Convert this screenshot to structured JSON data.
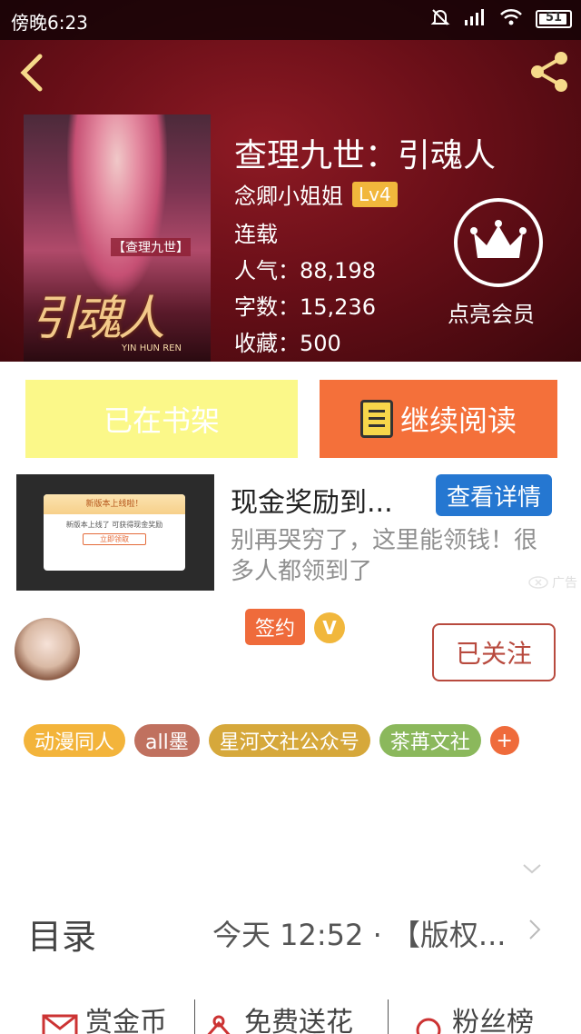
{
  "status_bar": {
    "time": "傍晚6:23",
    "battery": "51"
  },
  "book": {
    "title": "查理九世：引魂人",
    "author": "念卿小姐姐",
    "level": "Lv4",
    "status": "连载",
    "popularity": "人气：88,198",
    "word_count": "字数：15,236",
    "favorites": "收藏：500",
    "cover": {
      "title_art": "引魂人",
      "pinyin": "YIN HUN REN",
      "subtitle": "【查理九世】"
    }
  },
  "membership": {
    "label": "点亮会员"
  },
  "actions": {
    "shelf_label": "已在书架",
    "read_label": "继续阅读"
  },
  "ad": {
    "title": "现金奖励到...",
    "detail_button": "查看详情",
    "description": "别再哭穷了，这里能领钱！很多人都领到了",
    "label": "广告",
    "card_title": "新版本上线啦！",
    "card_text": "新版本上线了 可获得现金奖励",
    "card_button": "立即领取"
  },
  "author_section": {
    "sign_badge": "签约",
    "v_badge": "V",
    "follow_label": "已关注"
  },
  "tags": [
    {
      "label": "动漫同人",
      "color": "#f3b43b"
    },
    {
      "label": "all墨",
      "color": "#c0715f"
    },
    {
      "label": "星河文社公众号",
      "color": "#d6a83b"
    },
    {
      "label": "茶苒文社",
      "color": "#8bb85c"
    }
  ],
  "tag_add": "+",
  "toc": {
    "label": "目录",
    "latest": "今天 12:52 · 【版权..."
  },
  "bottom_bar": {
    "reward": "赏金币",
    "flowers": "免费送花",
    "fans": "粉丝榜"
  },
  "colors": {
    "accent_orange": "#f4703a",
    "shelf_yellow": "#fbf889",
    "ad_blue": "#2577d1",
    "follow_red": "#b84a3e"
  }
}
